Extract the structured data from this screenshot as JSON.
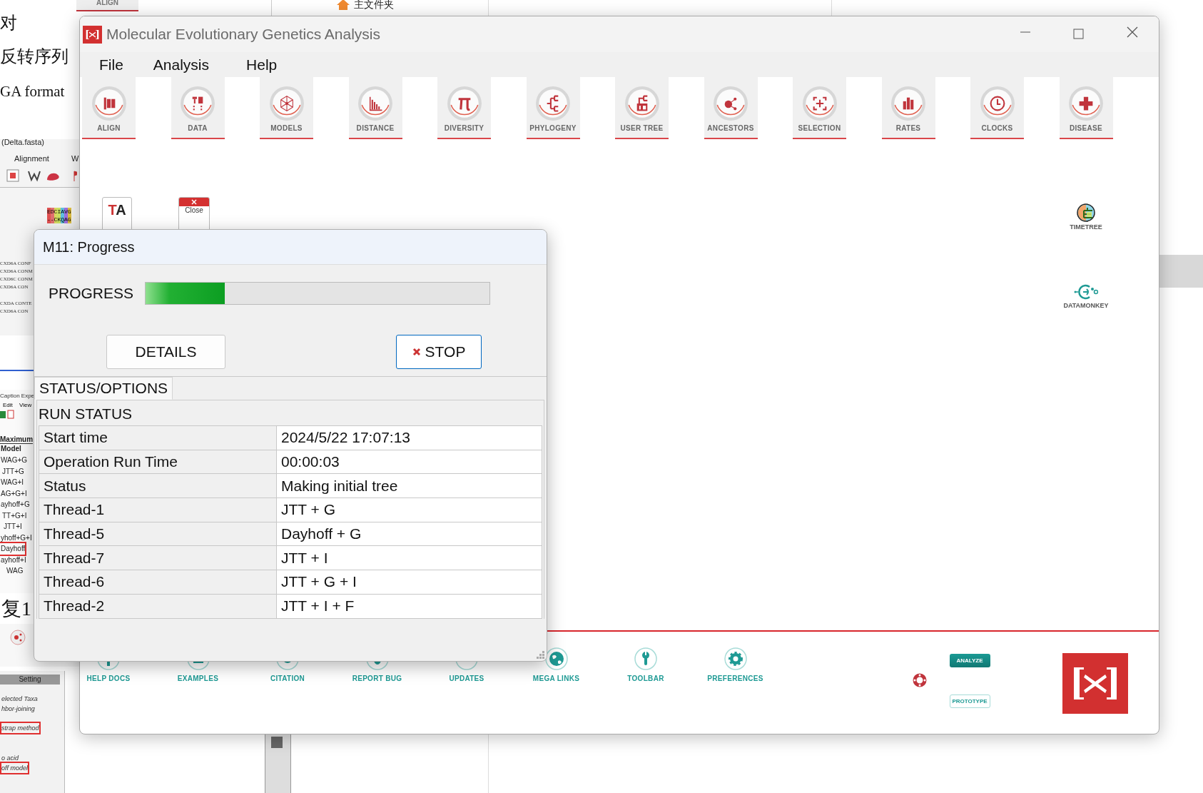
{
  "background": {
    "top_tab": "ALIGN",
    "folder": "主文件夹",
    "document_lines": [
      "对",
      "反转序列",
      "GA format"
    ],
    "alignment_window": {
      "title": "(Delta.fasta)",
      "menus": [
        "Alignment",
        "W"
      ],
      "alignment_cells": [
        "EDCIAVG",
        "--CKQAG"
      ],
      "sequence_rows": [
        "CXD6A CONF",
        "CXD6A CONM",
        "CXD6C CONM",
        "CXD6A CON",
        "CXDA CONTE",
        "CXD6A CON"
      ]
    },
    "caption_window": {
      "title": "Caption Expe",
      "menus": [
        "Edit",
        "View"
      ],
      "heading": "Maximum",
      "column": "Model",
      "models": [
        {
          "label": "WAG+G",
          "highlighted": false
        },
        {
          "label": "JTT+G",
          "highlighted": false
        },
        {
          "label": "WAG+I",
          "highlighted": false
        },
        {
          "label": "AG+G+I",
          "highlighted": false
        },
        {
          "label": "ayhoff+G",
          "highlighted": false
        },
        {
          "label": "TT+G+I",
          "highlighted": false
        },
        {
          "label": "JTT+I",
          "highlighted": false
        },
        {
          "label": "yhoff+G+I",
          "highlighted": false
        },
        {
          "label": "Dayhoff",
          "highlighted": true
        },
        {
          "label": "ayhoff+I",
          "highlighted": false
        },
        {
          "label": "WAG",
          "highlighted": false
        }
      ]
    },
    "document_line_2": "复1",
    "settings_window": {
      "header": "Setting",
      "rows": [
        {
          "label": "elected Taxa",
          "highlighted": false
        },
        {
          "label": "hbor-joining",
          "highlighted": false
        },
        {
          "label": "strap method",
          "highlighted": true
        },
        {
          "label": "o acid",
          "highlighted": false
        },
        {
          "label": "off model",
          "highlighted": true
        }
      ]
    }
  },
  "mega_window": {
    "title": "Molecular Evolutionary Genetics Analysis",
    "menu": [
      "File",
      "Analysis",
      "Help"
    ],
    "toolbar": [
      "ALIGN",
      "DATA",
      "MODELS",
      "DISTANCE",
      "DIVERSITY",
      "PHYLOGENY",
      "USER TREE",
      "ANCESTORS",
      "SELECTION",
      "RATES",
      "CLOCKS",
      "DISEASE"
    ],
    "launcher": [
      "TA",
      "Close"
    ],
    "side_links": [
      "TIMETREE",
      "DATAMONKEY"
    ],
    "footer_links": [
      "HELP DOCS",
      "EXAMPLES",
      "CITATION",
      "REPORT BUG",
      "UPDATES",
      "MEGA LINKS",
      "TOOLBAR",
      "PREFERENCES"
    ],
    "buttons": [
      "ANALYZE",
      "PROTOTYPE"
    ]
  },
  "progress_dialog": {
    "title": "M11: Progress",
    "progress": {
      "label": "PROGRESS",
      "level": 0.23
    },
    "buttons": [
      {
        "label": "DETAILS",
        "kind": "plain"
      },
      {
        "label": "STOP",
        "kind": "stop"
      }
    ],
    "tabs": [
      {
        "label": "STATUS/OPTIONS",
        "selected": true
      }
    ],
    "section": "RUN STATUS",
    "rows": [
      {
        "name": "Start time",
        "value": "2024/5/22 17:07:13"
      },
      {
        "name": "Operation Run Time",
        "value": "00:00:03"
      },
      {
        "name": "Status",
        "value": "Making initial tree"
      },
      {
        "name": "Thread-1",
        "value": "JTT + G"
      },
      {
        "name": "Thread-5",
        "value": "Dayhoff + G"
      },
      {
        "name": "Thread-7",
        "value": "JTT + I"
      },
      {
        "name": "Thread-6",
        "value": "JTT + G + I"
      },
      {
        "name": "Thread-2",
        "value": "JTT + I + F"
      }
    ]
  }
}
